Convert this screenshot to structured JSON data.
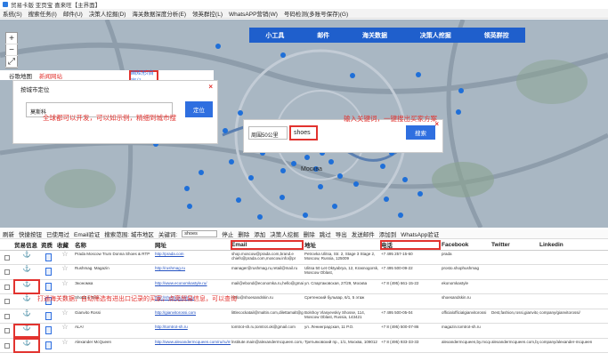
{
  "title": "贸易卡版 亚页宝 喜来旺【主界面】",
  "menu": [
    "系统(S)",
    "搜索任务(I)",
    "邮件(U)",
    "决策人挖掘(D)",
    "海关数据深度分析(E)",
    "领英群控(L)",
    "WhatsAPP营销(W)",
    "号码检测(多账号保存)(G)"
  ],
  "navbar": [
    "小工具",
    "邮件",
    "海关数据",
    "决策人挖掘",
    "领英群控"
  ],
  "zoom": [
    "+",
    "−",
    "⤢"
  ],
  "geo_tabs": {
    "tab1": "谷歌地图",
    "tab2": "新闻网站"
  },
  "locate_panel": {
    "label": "按城市定位",
    "input_value": "莫斯科",
    "button": "定位",
    "close": "×"
  },
  "draw_button": "画矩形/自定义",
  "annotations": {
    "note1": "全球都可以开发，可以如示例，精细到城市搜",
    "note2": "输入关键词，一键搜出买家方案",
    "note3": "打通海关数据，自动筛选有进出口记录的买家，点亮贸易信息，可以查询"
  },
  "search_panel": {
    "radius_select": "周围50公里",
    "keyword": "shoes",
    "button": "搜索",
    "close": "×"
  },
  "map_label": "Москва",
  "toolbar": {
    "items1": [
      "刷新",
      "快捷按钮",
      "已使用过",
      "Email验证",
      "搜索范围: 城市地区",
      "关键词:"
    ],
    "keyword": "shoes",
    "items2": [
      "停止",
      "删除",
      "添加",
      "决策人挖掘",
      "删除",
      "跳过",
      "导出",
      "发送邮件",
      "添加到",
      "WhatsApp验证"
    ]
  },
  "table": {
    "headers": [
      "",
      "贸易信息",
      "资质",
      "收藏",
      "名称",
      "网址",
      "Email",
      "地址",
      "电话",
      "Facebook",
      "Twitter",
      "Linkedin"
    ],
    "rows": [
      {
        "name": "Prada Moscow Trum Donna Shoes & RTP",
        "url": "http://prada.com",
        "email": "shop.moscow@prada.com,brand.e chiefs@prada.com,moscow.info@pr",
        "address": "Petrovka Ulitsa, Str. 2, Stage 3 Stage 2, Moscow, Russia, 125009",
        "phone": "+7 495 257-15-60",
        "facebook": "prada",
        "twitter": "",
        "linkedin": ""
      },
      {
        "name": "Rushmag. Magazin",
        "url": "http://rushmag.ru",
        "email": "manager@rushmag.ru,retail@mail.ru",
        "address": "Ulitsa 50 Let Oktyabrya, 12, Krasnogorsk, Moscow Oblast,",
        "phone": "+7 495 500-09-22",
        "facebook": "prosto.shophushmag",
        "twitter": "",
        "linkedin": ""
      },
      {
        "name": "Экономка",
        "url": "http://www.economkastyle.ru/",
        "email": "mail@ebond@economka.ru,hello@gmail.com",
        "address": "ул. Спартаковская, 27/29, Москва",
        "phone": "+7 8 (495) 661-15-22",
        "facebook": "ekonomkastyle",
        "twitter": "",
        "linkedin": ""
      },
      {
        "name": "Shoes & Skin",
        "url": "http://shoesandskin.ru",
        "email": "hello@shoesandskin.ru",
        "address": "Сретенский бульвар, 6/1, 5 этаж",
        "phone": "",
        "facebook": "shoesandskin.ru",
        "twitter": "",
        "linkedin": ""
      },
      {
        "name": "Gianvito Rossi",
        "url": "http://gianvitorossi.com",
        "email": "littlecockatail@maltin.com,dilettamalt@gmail.com,n.praktikal@mail",
        "address": "Bolshoy Vlasyevskiy Shosse, 114, Moscow Oblast, Russia, 143421",
        "phone": "+7 495 500-05-04",
        "facebook": "officialofficialgianvitorossi",
        "twitter": "Dest,fashion,rossi,gianvito_rossi",
        "linkedin": "company/gianvitorossi/"
      },
      {
        "name": "ALA!",
        "url": "http://tomtrot-sh.ru",
        "email": "tomtrot-sh.ru,tomtrot.ok@gmail.com",
        "address": "ул. Ленинградская, 11 Р.О.",
        "phone": "+7 8 (495) 500-07-86",
        "facebook": "magazin.tomtrot-sh.ru",
        "twitter": "",
        "linkedin": ""
      },
      {
        "name": "Alexander McQueen",
        "url": "http://www.alexandermcqueen.com/ru/ru/mens/..",
        "email": "lnstitute.main@alexandermcqueen.com,shoes.moscow@alexmc.com",
        "address": "Третьяковский пр., 1/1, Москва, 109012",
        "phone": "+7 8 (495) 933-33-33",
        "facebook": "alexandermcqueen,by.mcqueen,worldwidemcqueen,com",
        "twitter": "alexandermcqueen.com,by.mcqueen.com",
        "linkedin": "company/alexander-mcqueen"
      }
    ]
  },
  "colors": {
    "accent": "#1f5fcc",
    "annotation": "#e2332f",
    "pin": "#1f6fd8"
  }
}
